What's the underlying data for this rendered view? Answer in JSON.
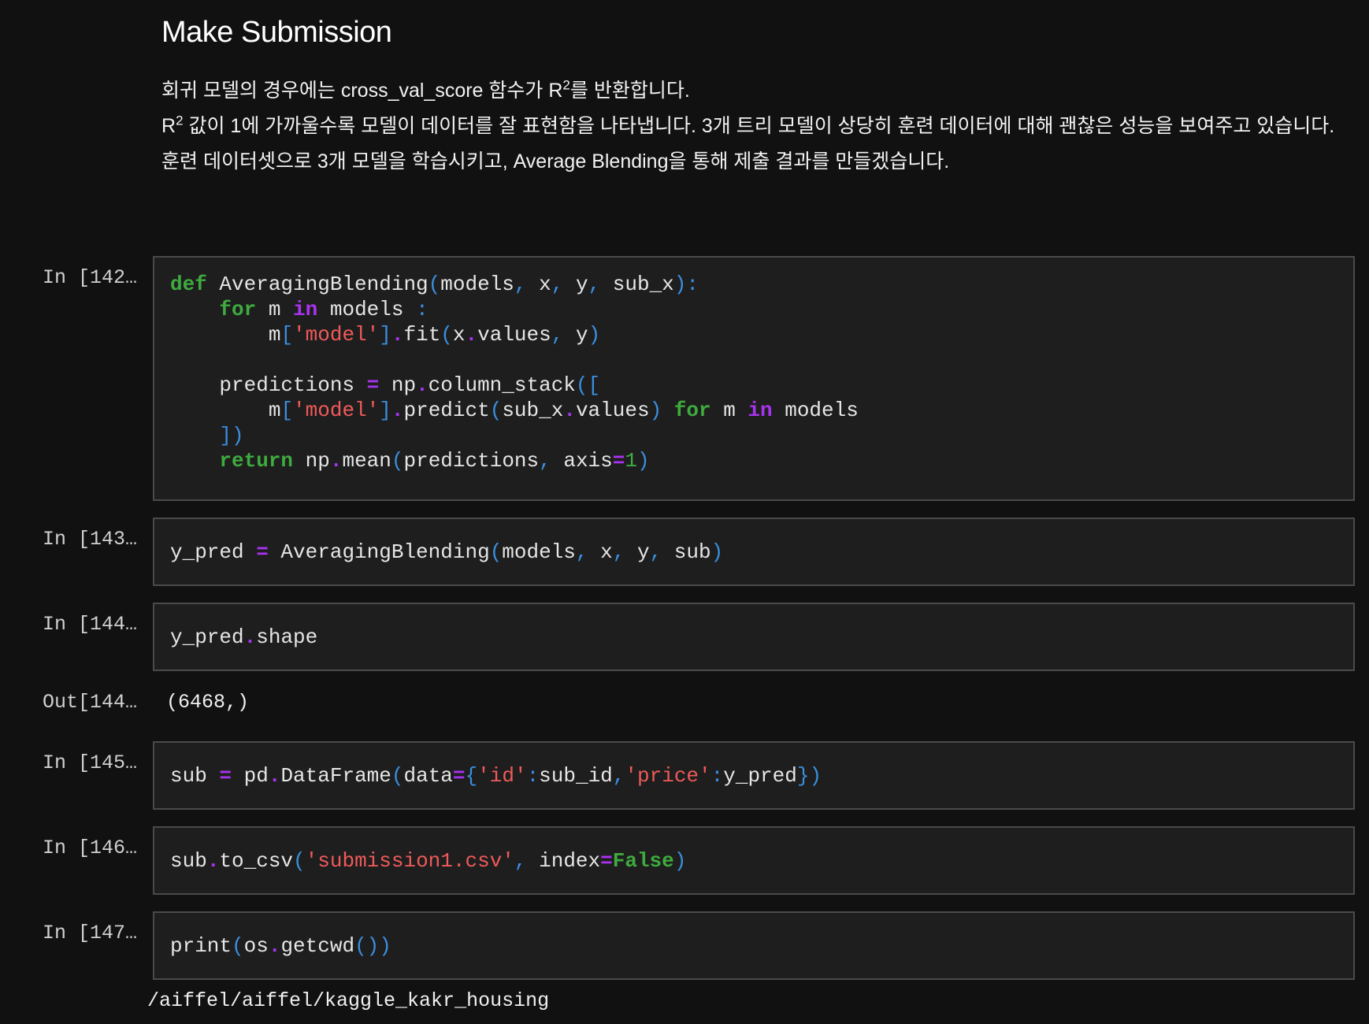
{
  "markdown": {
    "title": "Make Submission",
    "p1_before": "회귀 모델의 경우에는 cross_val_score 함수가 R",
    "p1_sup": "2",
    "p1_after": "를 반환합니다.",
    "p2_before": "R",
    "p2_sup": "2",
    "p2_after": " 값이 1에 가까울수록 모델이 데이터를 잘 표현함을 나타냅니다. 3개 트리 모델이 상당히 훈련 데이터에 대해 괜찮은 성능을 보여주고 있습니다.",
    "p3": "훈련 데이터셋으로 3개 모델을 학습시키고, Average Blending을 통해 제출 결과를 만들겠습니다."
  },
  "cells": [
    {
      "prompt": "In [142…",
      "lines": [
        [
          [
            "kw",
            "def"
          ],
          [
            "t",
            " AveragingBlending"
          ],
          [
            "p",
            "("
          ],
          [
            "t",
            "models"
          ],
          [
            "p",
            ","
          ],
          [
            "t",
            " x"
          ],
          [
            "p",
            ","
          ],
          [
            "t",
            " y"
          ],
          [
            "p",
            ","
          ],
          [
            "t",
            " sub_x"
          ],
          [
            "p",
            "):"
          ]
        ],
        [
          [
            "t",
            "    "
          ],
          [
            "kw",
            "for"
          ],
          [
            "t",
            " m "
          ],
          [
            "kw2",
            "in"
          ],
          [
            "t",
            " models "
          ],
          [
            "p",
            ":"
          ]
        ],
        [
          [
            "t",
            "        m"
          ],
          [
            "p",
            "["
          ],
          [
            "str",
            "'model'"
          ],
          [
            "p",
            "]"
          ],
          [
            "op",
            "."
          ],
          [
            "t",
            "fit"
          ],
          [
            "p",
            "("
          ],
          [
            "t",
            "x"
          ],
          [
            "op",
            "."
          ],
          [
            "t",
            "values"
          ],
          [
            "p",
            ","
          ],
          [
            "t",
            " y"
          ],
          [
            "p",
            ")"
          ]
        ],
        [
          [
            "t",
            " "
          ]
        ],
        [
          [
            "t",
            "    predictions "
          ],
          [
            "op",
            "="
          ],
          [
            "t",
            " np"
          ],
          [
            "op",
            "."
          ],
          [
            "t",
            "column_stack"
          ],
          [
            "p",
            "(["
          ]
        ],
        [
          [
            "t",
            "        m"
          ],
          [
            "p",
            "["
          ],
          [
            "str",
            "'model'"
          ],
          [
            "p",
            "]"
          ],
          [
            "op",
            "."
          ],
          [
            "t",
            "predict"
          ],
          [
            "p",
            "("
          ],
          [
            "t",
            "sub_x"
          ],
          [
            "op",
            "."
          ],
          [
            "t",
            "values"
          ],
          [
            "p",
            ")"
          ],
          [
            "t",
            " "
          ],
          [
            "kw",
            "for"
          ],
          [
            "t",
            " m "
          ],
          [
            "kw2",
            "in"
          ],
          [
            "t",
            " models"
          ]
        ],
        [
          [
            "t",
            "    "
          ],
          [
            "p",
            "])"
          ]
        ],
        [
          [
            "t",
            "    "
          ],
          [
            "kw",
            "return"
          ],
          [
            "t",
            " np"
          ],
          [
            "op",
            "."
          ],
          [
            "t",
            "mean"
          ],
          [
            "p",
            "("
          ],
          [
            "t",
            "predictions"
          ],
          [
            "p",
            ","
          ],
          [
            "t",
            " axis"
          ],
          [
            "op",
            "="
          ],
          [
            "num",
            "1"
          ],
          [
            "p",
            ")"
          ]
        ]
      ]
    },
    {
      "prompt": "In [143…",
      "lines": [
        [
          [
            "t",
            "y_pred "
          ],
          [
            "op",
            "="
          ],
          [
            "t",
            " AveragingBlending"
          ],
          [
            "p",
            "("
          ],
          [
            "t",
            "models"
          ],
          [
            "p",
            ","
          ],
          [
            "t",
            " x"
          ],
          [
            "p",
            ","
          ],
          [
            "t",
            " y"
          ],
          [
            "p",
            ","
          ],
          [
            "t",
            " sub"
          ],
          [
            "p",
            ")"
          ]
        ]
      ]
    },
    {
      "prompt": "In [144…",
      "lines": [
        [
          [
            "t",
            "y_pred"
          ],
          [
            "op",
            "."
          ],
          [
            "t",
            "shape"
          ]
        ]
      ],
      "out_prompt": "Out[144…",
      "output": "(6468,)"
    },
    {
      "prompt": "In [145…",
      "lines": [
        [
          [
            "t",
            "sub "
          ],
          [
            "op",
            "="
          ],
          [
            "t",
            " pd"
          ],
          [
            "op",
            "."
          ],
          [
            "t",
            "DataFrame"
          ],
          [
            "p",
            "("
          ],
          [
            "t",
            "data"
          ],
          [
            "op",
            "="
          ],
          [
            "p",
            "{"
          ],
          [
            "str",
            "'id'"
          ],
          [
            "p",
            ":"
          ],
          [
            "t",
            "sub_id"
          ],
          [
            "p",
            ","
          ],
          [
            "str",
            "'price'"
          ],
          [
            "p",
            ":"
          ],
          [
            "t",
            "y_pred"
          ],
          [
            "p",
            "})"
          ]
        ]
      ]
    },
    {
      "prompt": "In [146…",
      "lines": [
        [
          [
            "t",
            "sub"
          ],
          [
            "op",
            "."
          ],
          [
            "t",
            "to_csv"
          ],
          [
            "p",
            "("
          ],
          [
            "str",
            "'submission1.csv'"
          ],
          [
            "p",
            ","
          ],
          [
            "t",
            " index"
          ],
          [
            "op",
            "="
          ],
          [
            "kw",
            "False"
          ],
          [
            "p",
            ")"
          ]
        ]
      ]
    },
    {
      "prompt": "In [147…",
      "lines": [
        [
          [
            "t",
            "print"
          ],
          [
            "p",
            "("
          ],
          [
            "t",
            "os"
          ],
          [
            "op",
            "."
          ],
          [
            "t",
            "getcwd"
          ],
          [
            "p",
            "())"
          ]
        ]
      ],
      "stdout": "/aiffel/aiffel/kaggle_kakr_housing"
    }
  ]
}
